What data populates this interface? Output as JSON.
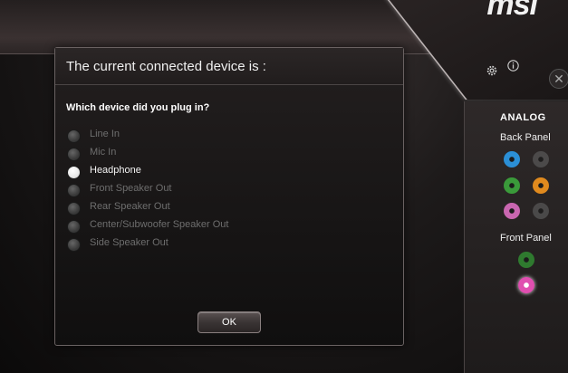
{
  "brand": {
    "logo_text": "msi"
  },
  "toolbar": {
    "gear_icon": "gear-icon",
    "info_icon": "info-icon",
    "close_icon": "close-icon",
    "close_glyph": "✕"
  },
  "dialog": {
    "title": "The current connected device is :",
    "question": "Which device did you plug in?",
    "options": [
      {
        "label": "Line In",
        "selected": false
      },
      {
        "label": "Mic In",
        "selected": false
      },
      {
        "label": "Headphone",
        "selected": true
      },
      {
        "label": "Front Speaker Out",
        "selected": false
      },
      {
        "label": "Rear Speaker Out",
        "selected": false
      },
      {
        "label": "Center/Subwoofer Speaker Out",
        "selected": false
      },
      {
        "label": "Side Speaker Out",
        "selected": false
      }
    ],
    "ok_label": "OK"
  },
  "side_panel": {
    "title": "ANALOG",
    "back_panel_label": "Back Panel",
    "front_panel_label": "Front Panel",
    "back_jacks": [
      {
        "name": "back-jack-blue",
        "color": "#2b8fd6",
        "active": true
      },
      {
        "name": "back-jack-gray-1",
        "color": "#5a5a5a",
        "active": false
      },
      {
        "name": "back-jack-green",
        "color": "#3a9a3a",
        "active": true
      },
      {
        "name": "back-jack-orange",
        "color": "#e08a1e",
        "active": true
      },
      {
        "name": "back-jack-pink",
        "color": "#c966b0",
        "active": true
      },
      {
        "name": "back-jack-gray-2",
        "color": "#5a5a5a",
        "active": false
      }
    ],
    "front_jacks": [
      {
        "name": "front-jack-green",
        "color": "#2f7a2f",
        "active": true
      },
      {
        "name": "front-jack-pink",
        "color": "#e04fb0",
        "active": true,
        "selected": true
      }
    ]
  }
}
